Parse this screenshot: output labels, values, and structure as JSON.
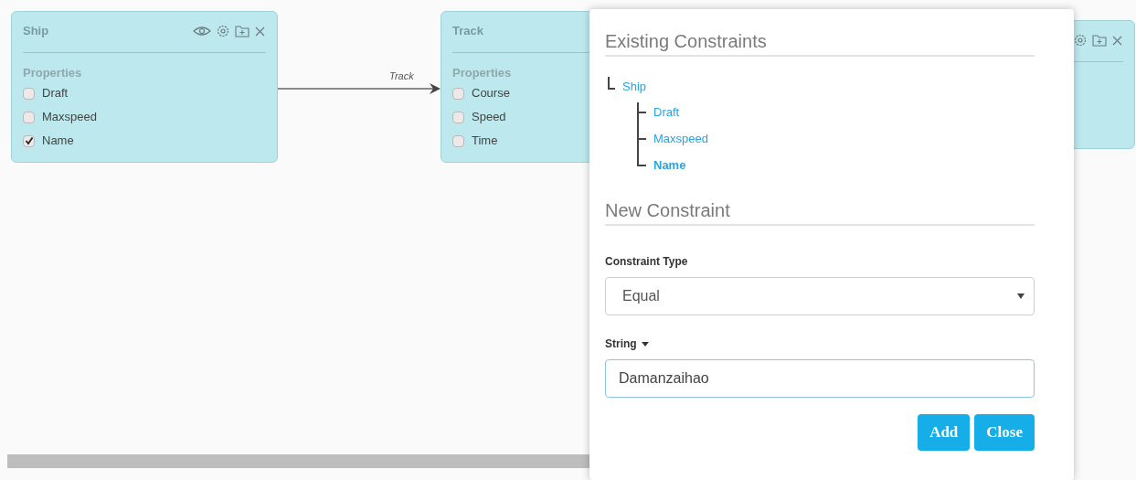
{
  "nodes": [
    {
      "kind": "full",
      "title": "Ship",
      "section_label": "Properties",
      "properties": [
        {
          "label": "Draft",
          "checked": false
        },
        {
          "label": "Maxspeed",
          "checked": false
        },
        {
          "label": "Name",
          "checked": true
        }
      ]
    },
    {
      "kind": "covered",
      "title": "Track",
      "section_label": "Properties",
      "properties": [
        {
          "label": "Course",
          "checked": false
        },
        {
          "label": "Speed",
          "checked": false
        },
        {
          "label": "Time",
          "checked": false
        }
      ]
    },
    {
      "kind": "header"
    }
  ],
  "edge": {
    "label": "Track"
  },
  "dialog": {
    "existing_title": "Existing Constraints",
    "tree": {
      "label": "Ship",
      "selected": false,
      "children": [
        {
          "label": "Draft",
          "selected": false
        },
        {
          "label": "Maxspeed",
          "selected": false
        },
        {
          "label": "Name",
          "selected": true
        }
      ]
    },
    "new_title": "New Constraint",
    "constraint_type": {
      "label": "Constraint Type",
      "value": "Equal"
    },
    "value_field": {
      "label": "String",
      "value": "Damanzaihao"
    },
    "buttons": [
      "Add",
      "Close"
    ]
  }
}
